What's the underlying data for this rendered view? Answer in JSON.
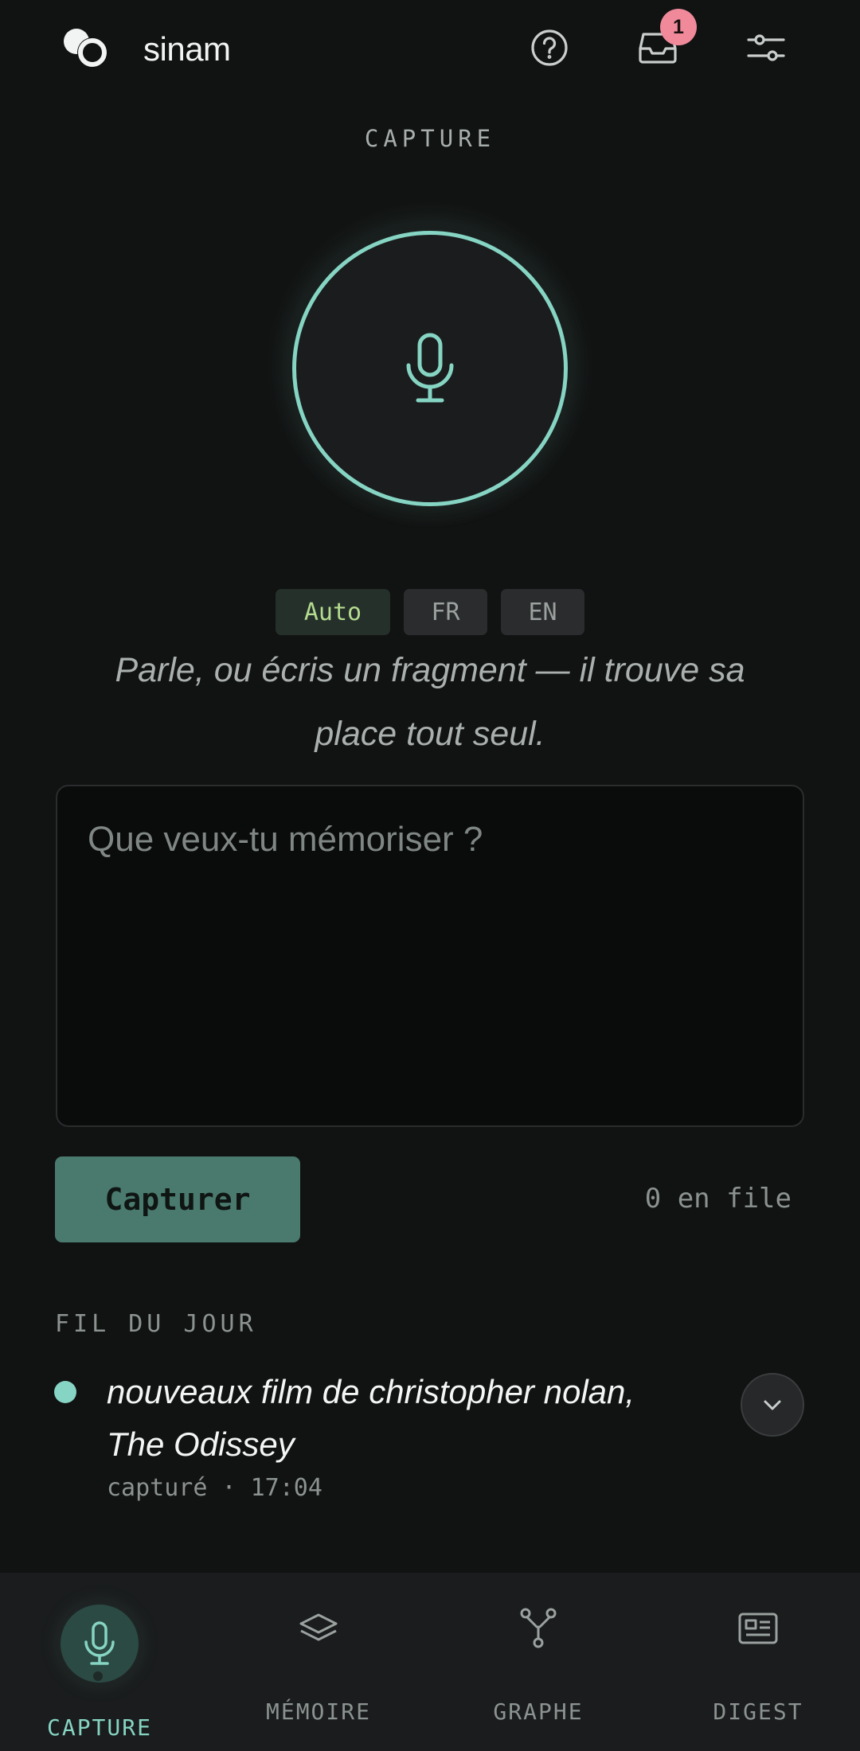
{
  "app": {
    "name": "sinam"
  },
  "header": {
    "notification_count": "1"
  },
  "page": {
    "section_title": "CAPTURE"
  },
  "languages": {
    "auto": "Auto",
    "fr": "FR",
    "en": "EN",
    "selected": "Auto"
  },
  "hint": "Parle, ou écris un fragment — il trouve sa place tout seul.",
  "input": {
    "placeholder": "Que veux-tu mémoriser ?",
    "value": ""
  },
  "actions": {
    "capture_label": "Capturer",
    "queue_status": "0 en file"
  },
  "feed": {
    "title": "FIL DU JOUR",
    "items": [
      {
        "text": "nouveaux film de christopher nolan, The Odissey",
        "meta": "capturé · 17:04"
      }
    ]
  },
  "nav": {
    "capture": "CAPTURE",
    "memoire": "MÉMOIRE",
    "graphe": "GRAPHE",
    "digest": "DIGEST",
    "active": "CAPTURE"
  },
  "colors": {
    "accent": "#86d4c3",
    "badge": "#f08a9b",
    "auto_chip_text": "#b4db8f"
  },
  "icons": {
    "logo": "sinam-logo-icon",
    "help": "help-icon",
    "inbox": "inbox-icon",
    "settings": "sliders-icon",
    "mic": "microphone-icon",
    "expand": "chevron-down-icon",
    "memoire": "layers-icon",
    "graphe": "graph-icon",
    "digest": "newspaper-icon"
  }
}
